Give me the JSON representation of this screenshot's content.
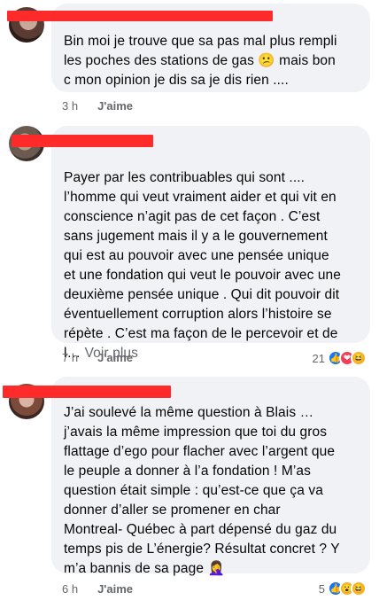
{
  "comments": [
    {
      "text": "Bin moi je trouve que sa pas mal plus rempli\nles poches des stations de gas 😕 mais bon\nc mon opinion je dis sa je dis rien ....",
      "time": "3 h",
      "like_label": "J'aime",
      "reaction_count": "",
      "reactions": []
    },
    {
      "text": "Payer par les contribuables qui sont ....\nl’homme qui veut vraiment aider et qui vit en\nconscience n’agit pas de cet façon . C’est\nsans jugement mais il y a le gouvernement\nqui est au pouvoir avec une pensée unique\net une fondation qui veut le pouvoir avec une\ndeuxième pensée unique . Qui dit pouvoir dit\néventuellement corruption alors l’histoire se\nrépète . C’est ma façon de le percevoir et de\nl…",
      "see_more": "Voir plus",
      "time": "7 h",
      "like_label": "J'aime",
      "reaction_count": "21",
      "reactions": [
        "like",
        "love",
        "haha"
      ]
    },
    {
      "text": "J’ai soulevé la même question à Blais …\nj’avais la même impression que toi du gros\nflattage d’ego pour flacher avec l’argent que\nle peuple a donner à l’a fondation ! M’as\nquestion était simple : qu’est-ce que ça va\ndonner d’aller se promener en char\nMontreal- Québec à part dépensé du gaz du\ntemps pis de L’énergie? Résultat concret ?  Y\nm’a bannis de sa page 🤦‍♀️",
      "time": "6 h",
      "like_label": "J'aime",
      "reaction_count": "5",
      "reactions": [
        "like",
        "wow",
        "haha"
      ]
    }
  ],
  "reaction_glyphs": {
    "like": "👍",
    "love": "❤",
    "haha": "😆",
    "wow": "😮"
  },
  "colors": {
    "bubble": "#f0f2f5",
    "redaction": "#ff2a2a",
    "meta": "#65676b"
  }
}
